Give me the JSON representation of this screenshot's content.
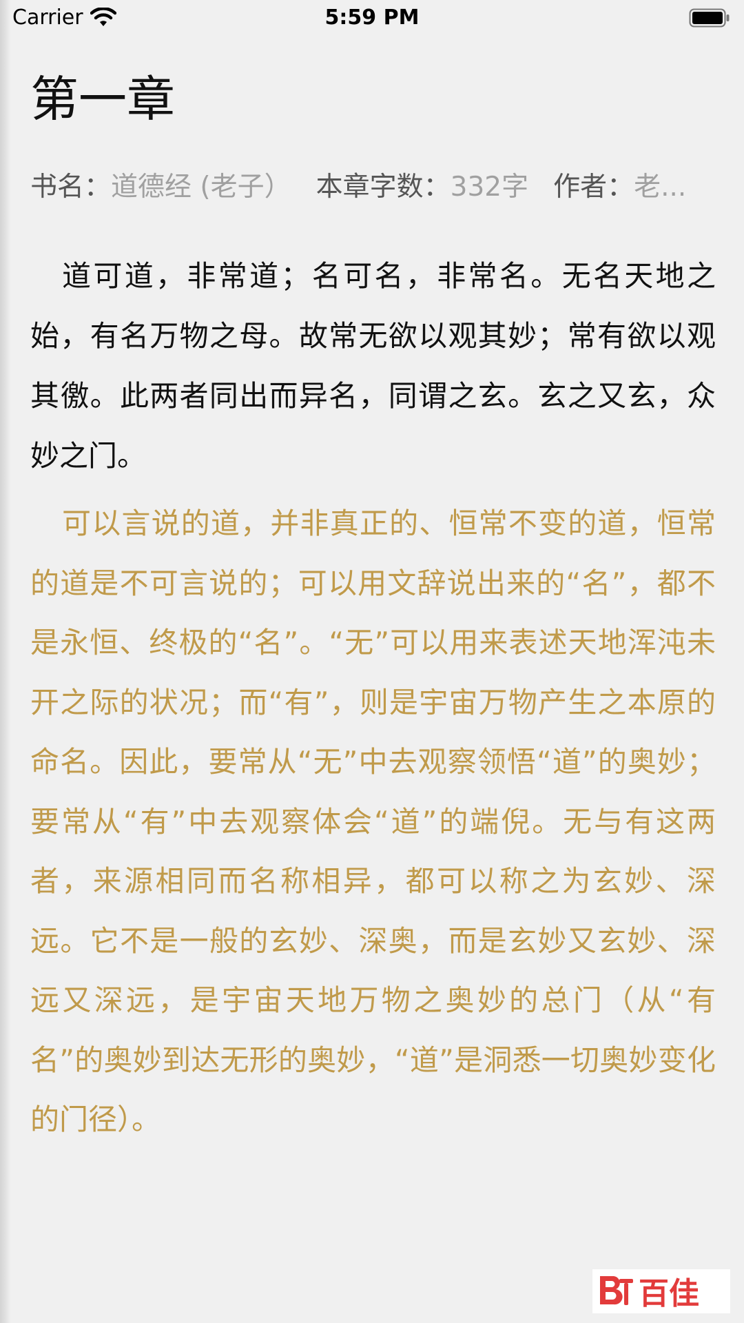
{
  "status_bar": {
    "carrier": "Carrier",
    "time": "5:59 PM"
  },
  "chapter": {
    "title": "第一章",
    "meta": {
      "book_label": "书名：",
      "book_value": "道德经 (老子）",
      "wordcount_label": "本章字数：",
      "wordcount_value": "332字",
      "author_label": "作者：",
      "author_value": "老..."
    },
    "original": "道可道，非常道；名可名，非常名。无名天地之始，有名万物之母。故常无欲以观其妙；常有欲以观其徼。此两者同出而异名，同谓之玄。玄之又玄，众妙之门。",
    "translation": "可以言说的道，并非真正的、恒常不变的道，恒常的道是不可言说的；可以用文辞说出来的“名”，都不是永恒、终极的“名”。“无”可以用来表述天地浑沌未开之际的状况；而“有”，则是宇宙万物产生之本原的命名。因此，要常从“无”中去观察领悟“道”的奥妙；要常从“有”中去观察体会“道”的端倪。无与有这两者，来源相同而名称相异，都可以称之为玄妙、深远。它不是一般的玄妙、深奥，而是玄妙又玄妙、深远又深远，是宇宙天地万物之奥妙的总门（从“有名”的奥妙到达无形的奥妙，“道”是洞悉一切奥妙变化的门径）。"
  },
  "watermark": {
    "logo_text": "百佳"
  },
  "colors": {
    "background": "#f0f0f0",
    "translation": "#c09a4a",
    "logo_red": "#e23b3b"
  }
}
